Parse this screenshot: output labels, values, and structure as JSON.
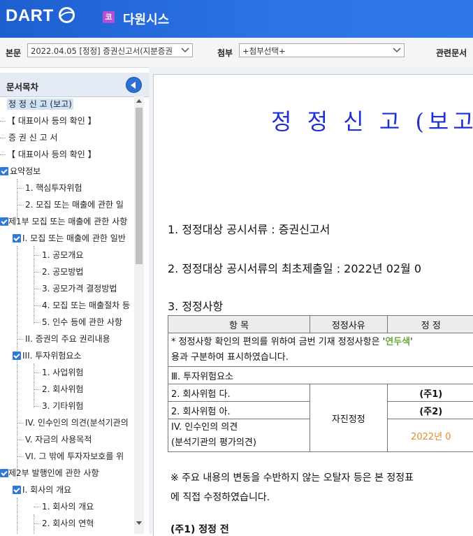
{
  "header": {
    "logo_text": "DART",
    "company_badge": "코",
    "company_name": "다원시스"
  },
  "toolbar": {
    "report_label": "본문",
    "report_value": "2022.04.05 [정정] 증권신고서(지분증권",
    "attach_label": "첨부",
    "attach_value": "+첨부선택+",
    "related_label": "관련문서"
  },
  "sidebar": {
    "title": "문서목차",
    "items": [
      {
        "label": "정 정 신 고 (보고)"
      },
      {
        "label": "【 대표이사 등의 확인 】"
      },
      {
        "label": "증 권 신 고 서"
      },
      {
        "label": "【 대표이사 등의 확인 】"
      },
      {
        "label": "요약정보"
      },
      {
        "label": "1. 핵심투자위험"
      },
      {
        "label": "2. 모집 또는 매출에 관한 일"
      },
      {
        "label": "제1부 모집 또는 매출에 관한 사항"
      },
      {
        "label": "I. 모집 또는 매출에 관한 일반"
      },
      {
        "label": "1. 공모개요"
      },
      {
        "label": "2. 공모방법"
      },
      {
        "label": "3. 공모가격 결정방법"
      },
      {
        "label": "4. 모집 또는 매출절차 등"
      },
      {
        "label": "5. 인수 등에 관한 사항"
      },
      {
        "label": "II. 증권의 주요 권리내용"
      },
      {
        "label": "III. 투자위험요소"
      },
      {
        "label": "1. 사업위험"
      },
      {
        "label": "2. 회사위험"
      },
      {
        "label": "3. 기타위험"
      },
      {
        "label": "IV. 인수인의 의견(분석기관의"
      },
      {
        "label": "V. 자금의 사용목적"
      },
      {
        "label": "VI. 그 밖에 투자자보호를 위"
      },
      {
        "label": "제2부 발행인에 관한 사항"
      },
      {
        "label": "I. 회사의 개요"
      },
      {
        "label": "1. 회사의 개요"
      },
      {
        "label": "2. 회사의 연혁"
      }
    ]
  },
  "document": {
    "title": "정 정 신 고 (보고)",
    "line1": "1. 정정대상 공시서류 : 증권신고서",
    "line2": "2. 정정대상 공시서류의 최초제출일 : 2022년 02월 0",
    "line3": "3. 정정사항",
    "table": {
      "headers": [
        "항 목",
        "정정사유",
        "정 정"
      ],
      "note_prefix": "* 정정사항 확인의 편의를 위하여 금번 기재 정정사항은 '",
      "note_highlight": "연두색",
      "note_suffix": "'",
      "note_line2": "용과 구분하여 표시하였습니다.",
      "section": "Ⅲ. 투자위험요소",
      "row1": "2. 회사위험 다.",
      "row1_note": "(주1)",
      "row2": "2. 회사위험 아.",
      "row2_note": "(주2)",
      "row3a": "IV. 인수인의 의견",
      "row3b": "(분석기관의 평가의견)",
      "row3_note": "2022년 0",
      "reason": "자진정정"
    },
    "footnote1": "※ 주요 내용의 변동을 수반하지 않는 오탈자 등은 본 정정표",
    "footnote2": "에 직접 수정하였습니다.",
    "subhead": "(주1) 정정 전",
    "highlight_color": "#6aa83a",
    "orange_color": "#e38a2c"
  }
}
